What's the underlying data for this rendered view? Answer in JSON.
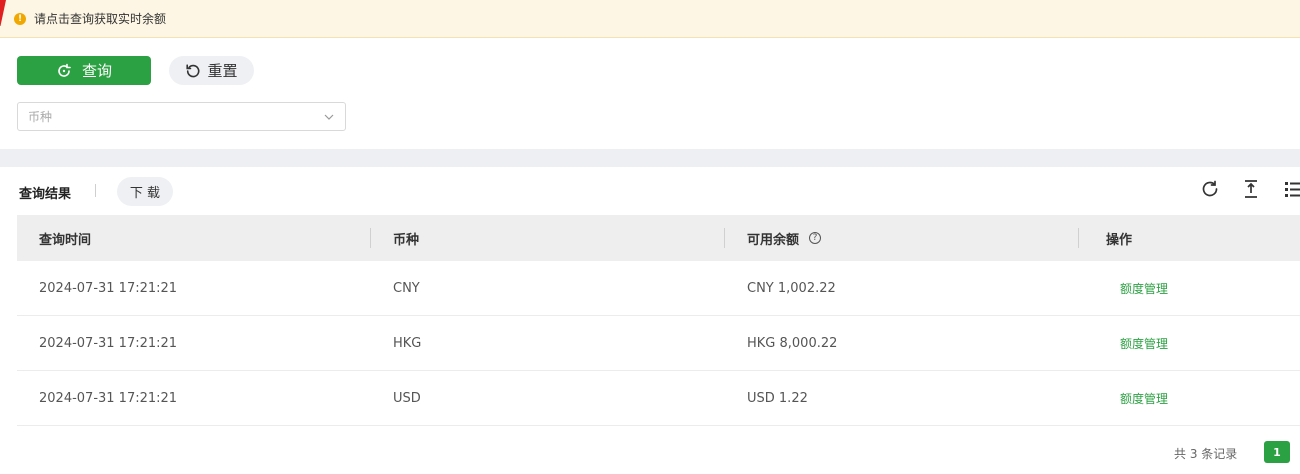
{
  "alert": {
    "text": "请点击查询获取实时余额",
    "icon": "warning-icon"
  },
  "actions": {
    "query_label": "查询",
    "reset_label": "重置"
  },
  "filter": {
    "currency_placeholder": "币种"
  },
  "results": {
    "title": "查询结果",
    "download_label": "下 载"
  },
  "table": {
    "headers": [
      "查询时间",
      "币种",
      "可用余额",
      "操作"
    ],
    "rows": [
      {
        "time": "2024-07-31 17:21:21",
        "currency": "CNY",
        "balance": "CNY 1,002.22",
        "action": "额度管理"
      },
      {
        "time": "2024-07-31 17:21:21",
        "currency": "HKG",
        "balance": "HKG 8,000.22",
        "action": "额度管理"
      },
      {
        "time": "2024-07-31 17:21:21",
        "currency": "USD",
        "balance": "USD 1.22",
        "action": "额度管理"
      }
    ]
  },
  "pagination": {
    "total_text": "共 3 条记录",
    "current_page": "1"
  },
  "colors": {
    "primary": "#2ca143",
    "alert_bg": "#fdf6e4",
    "warning": "#f0a800"
  }
}
